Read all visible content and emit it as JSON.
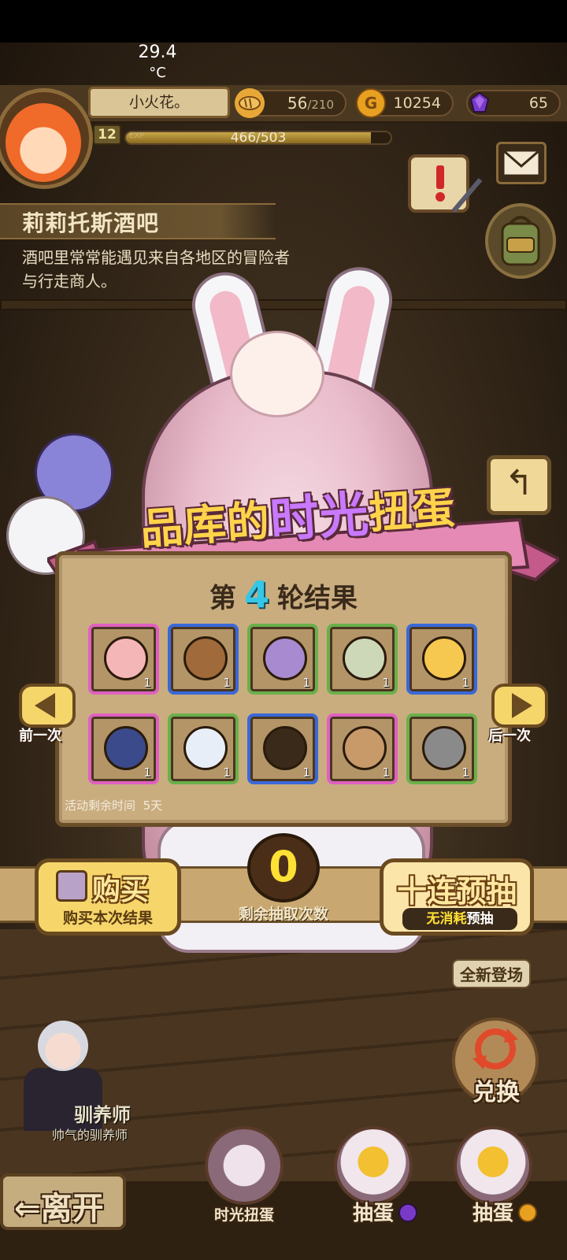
{
  "status_bar": {
    "temperature": "29.4",
    "unit": "°C"
  },
  "player": {
    "name": "小火花。",
    "level": "12",
    "exp_label": "EXP",
    "exp_text": "466/503",
    "exp_current": 466,
    "exp_max": 503
  },
  "resources": {
    "stamina": {
      "value": "56",
      "max": "/210",
      "icon": "bread-icon",
      "color": "#e8a838"
    },
    "gold": {
      "value": "10254",
      "icon": "gold-coin-icon",
      "color": "#e8a020"
    },
    "gem": {
      "value": "65",
      "icon": "purple-gem-icon",
      "color": "#7a3ac8"
    }
  },
  "location": {
    "title": "莉莉托斯酒吧",
    "description": "酒吧里常常能遇见来自各地区的冒险者与行走商人。"
  },
  "gacha": {
    "title_part1": "品库的",
    "title_highlight": "时光",
    "title_part2": "扭蛋",
    "round_prefix": "第",
    "round_number": "4",
    "round_suffix": "轮结果",
    "remaining_time_label": "活动剩余时间",
    "remaining_time_value": "5天",
    "prev_label": "前一次",
    "next_label": "后一次",
    "items_row1": [
      {
        "quantity": "1",
        "rarity": "pink",
        "icon": "pink-bird-icon",
        "color": "#f4b6b6"
      },
      {
        "quantity": "1",
        "rarity": "blue",
        "icon": "berry-cake-icon",
        "color": "#a06a3a"
      },
      {
        "quantity": "1",
        "rarity": "green",
        "icon": "purple-feather-icon",
        "color": "#a88ad0"
      },
      {
        "quantity": "1",
        "rarity": "green",
        "icon": "spotted-egg-icon",
        "color": "#cdd8b8"
      },
      {
        "quantity": "1",
        "rarity": "blue",
        "icon": "sun-ornament-icon",
        "color": "#f6c850"
      }
    ],
    "items_row2": [
      {
        "quantity": "1",
        "rarity": "pink",
        "icon": "feather-hat-icon",
        "color": "#3a4a8a"
      },
      {
        "quantity": "1",
        "rarity": "green",
        "icon": "cloud-planet-icon",
        "color": "#e8eef8"
      },
      {
        "quantity": "1",
        "rarity": "blue",
        "icon": "bat-wings-icon",
        "color": "#3a2a1a"
      },
      {
        "quantity": "1",
        "rarity": "pink",
        "icon": "tiger-mask-icon",
        "color": "#c89a6a"
      },
      {
        "quantity": "1",
        "rarity": "green",
        "icon": "gray-hair-icon",
        "color": "#8a8a8a"
      }
    ],
    "buy_button": {
      "title": "购买",
      "subtitle": "购买本次结果"
    },
    "draw_count": "0",
    "draw_count_label": "剩余抽取次数",
    "ten_draw_button": {
      "title": "十连预抽",
      "subtitle_highlight": "无消耗",
      "subtitle_rest": "预抽"
    }
  },
  "side": {
    "new_arrival": "全新登场",
    "exchange": "兑换"
  },
  "trainer": {
    "name": "驯养师",
    "title": "帅气的驯养师"
  },
  "bottom_nav": {
    "leave": "离开",
    "time_gacha": "时光扭蛋",
    "draw_gem": "抽蛋",
    "draw_gold": "抽蛋"
  },
  "colors": {
    "title_gold": "#ffd44a",
    "title_purple": "#c879ff",
    "round_number": "#36c6e6",
    "draw_count": "#ffe034"
  }
}
